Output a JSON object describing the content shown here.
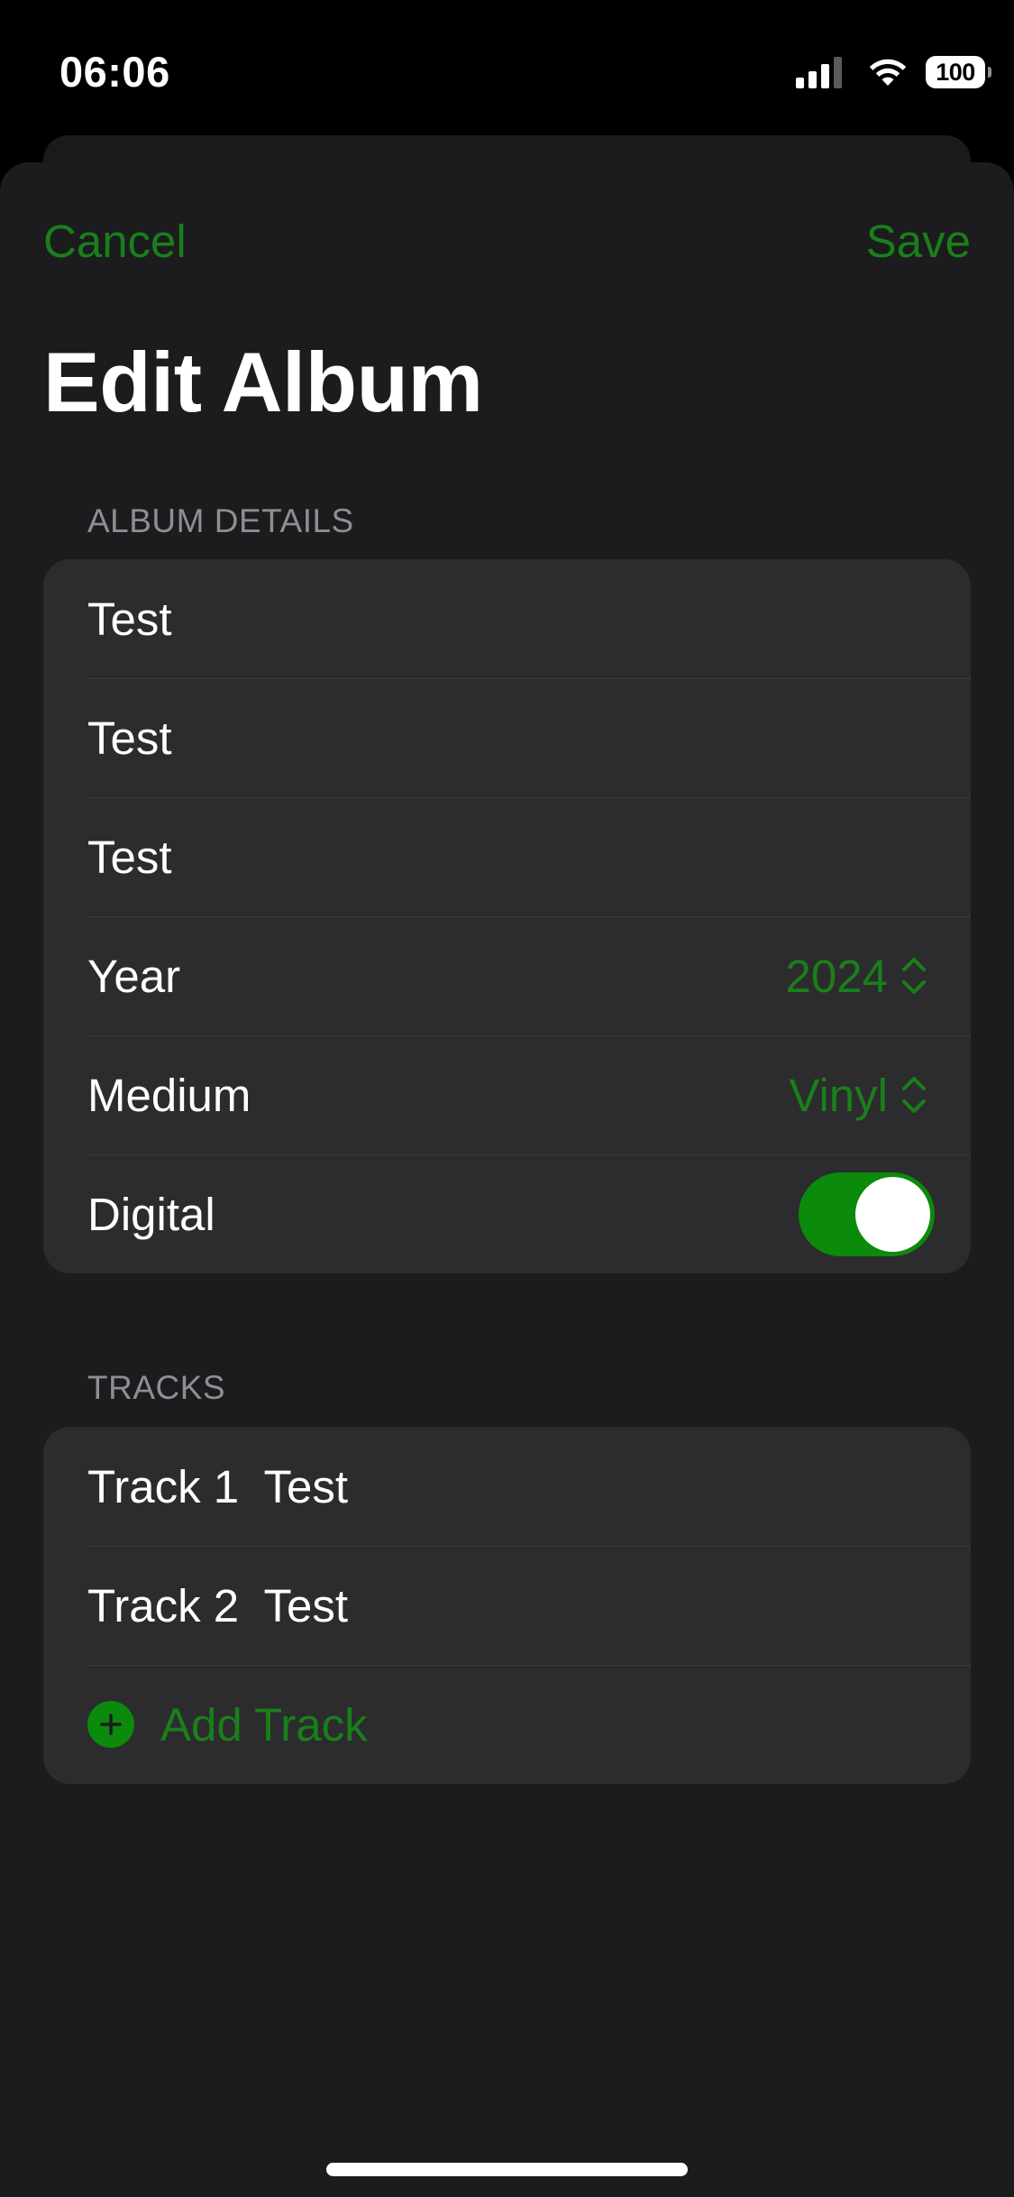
{
  "status_bar": {
    "time": "06:06",
    "battery": "100",
    "signal_icon": "cellular-signal-icon",
    "wifi_icon": "wifi-icon"
  },
  "nav": {
    "cancel_label": "Cancel",
    "save_label": "Save"
  },
  "title": "Edit Album",
  "album_details": {
    "header": "ALBUM DETAILS",
    "fields": [
      {
        "value": "Test"
      },
      {
        "value": "Test"
      },
      {
        "value": "Test"
      }
    ],
    "year": {
      "label": "Year",
      "value": "2024"
    },
    "medium": {
      "label": "Medium",
      "value": "Vinyl"
    },
    "digital": {
      "label": "Digital",
      "enabled": true
    }
  },
  "tracks": {
    "header": "TRACKS",
    "items": [
      {
        "label": "Track 1  Test"
      },
      {
        "label": "Track 2  Test"
      }
    ],
    "add_label": "Add Track"
  },
  "colors": {
    "accent": "#1a7f1a",
    "toggle_on": "#0b8a0b",
    "sheet_background": "#1c1c1e",
    "group_background": "#2c2c2e",
    "secondary_text": "#8e8e93"
  }
}
